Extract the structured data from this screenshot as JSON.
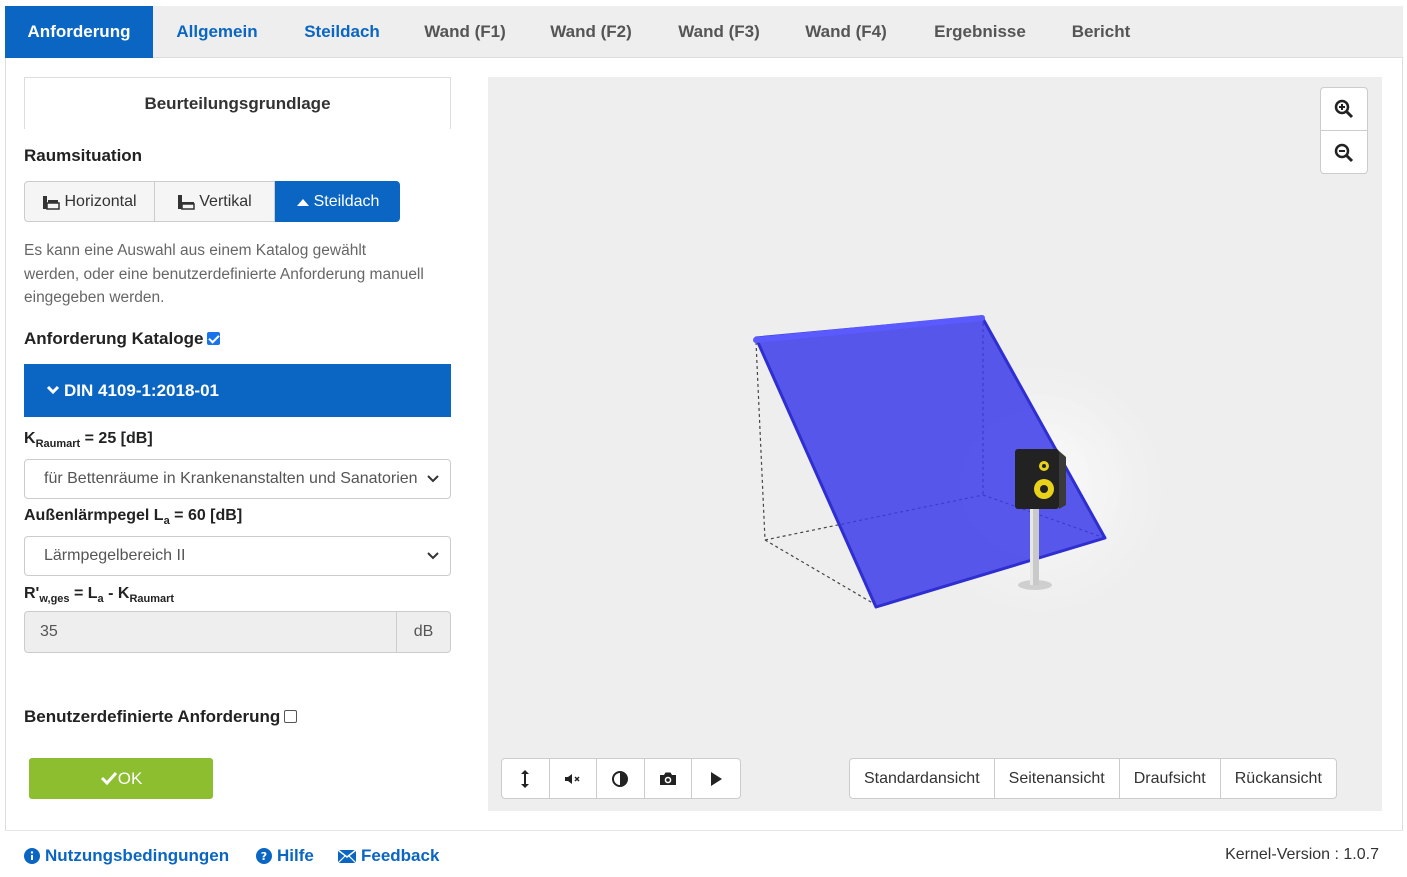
{
  "tabs": [
    {
      "label": "Anforderung"
    },
    {
      "label": "Allgemein"
    },
    {
      "label": "Steildach"
    },
    {
      "label": "Wand (F1)"
    },
    {
      "label": "Wand (F2)"
    },
    {
      "label": "Wand (F3)"
    },
    {
      "label": "Wand (F4)"
    },
    {
      "label": "Ergebnisse"
    },
    {
      "label": "Bericht"
    }
  ],
  "panel": {
    "subtab": "Beurteilungsgrundlage",
    "raumsituation_title": "Raumsituation",
    "raum_buttons": [
      {
        "label": "Horizontal"
      },
      {
        "label": "Vertikal"
      },
      {
        "label": "Steildach"
      }
    ],
    "help_text": "Es kann eine Auswahl aus einem Katalog gewählt werden, oder eine benutzerdefinierte Anforderung manuell eingegeben werden.",
    "kataloge_label": "Anforderung Kataloge",
    "catalog": "DIN 4109-1:2018-01",
    "k_raumart": {
      "k": "K",
      "sub": "Raumart",
      "eq": " = 25 [dB]"
    },
    "raumart_select": "für Bettenräume in Krankenanstalten und Sanatorien",
    "aussenlaerm": {
      "label": "Außenlärmpegel L",
      "sub": "a",
      "eq": " = 60 [dB]"
    },
    "laerm_select": "Lärmpegelbereich II",
    "rw_formula": {
      "r": "R'",
      "sub1": "w,ges",
      "mid": " = L",
      "sub2": "a",
      "minus": " - K",
      "sub3": "Raumart"
    },
    "rw_value": "35",
    "rw_unit": "dB",
    "custom_label": "Benutzerdefinierte Anforderung",
    "ok_label": "OK"
  },
  "viewer": {
    "tool_icons": [
      "vertical-arrows-icon",
      "mute-icon",
      "contrast-icon",
      "camera-icon",
      "play-icon"
    ],
    "views": [
      {
        "label": "Standardansicht"
      },
      {
        "label": "Seitenansicht"
      },
      {
        "label": "Draufsicht"
      },
      {
        "label": "Rückansicht"
      }
    ]
  },
  "colors": {
    "primary": "#0a66c2",
    "ok_green": "#8cbe2f",
    "roof_blue": "#3b3bea"
  },
  "footer": {
    "links": [
      {
        "label": "Nutzungsbedingungen"
      },
      {
        "label": "Hilfe"
      },
      {
        "label": "Feedback"
      }
    ],
    "kernel_label": "Kernel-Version :",
    "kernel_value": "1.0.7"
  }
}
